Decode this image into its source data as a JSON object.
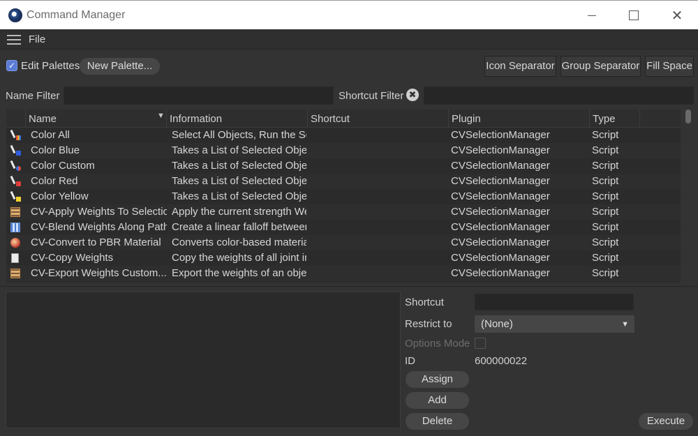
{
  "window": {
    "title": "Command Manager",
    "close_glyph": "✕"
  },
  "menu": {
    "file": "File"
  },
  "toolbar": {
    "edit_palettes_label": "Edit Palettes",
    "edit_palettes_checked": true,
    "checkmark": "✓",
    "new_palette": "New Palette...",
    "icon_separator": "Icon Separator",
    "group_separator": "Group Separator",
    "fill_space": "Fill Space"
  },
  "filters": {
    "name_label": "Name Filter",
    "shortcut_label": "Shortcut Filter",
    "name_value": "",
    "shortcut_value": "",
    "clear_glyph": "✖"
  },
  "table": {
    "columns": [
      "Name",
      "Information",
      "Shortcut",
      "Plugin",
      "Type"
    ],
    "sort_glyph": "▼",
    "rows": [
      {
        "icon": "color-all-icon",
        "name": "Color All",
        "information": "Select All Objects, Run the Scri",
        "shortcut": "",
        "plugin": "CVSelectionManager",
        "type": "Script"
      },
      {
        "icon": "color-blue-icon",
        "name": "Color Blue",
        "information": "Takes a List of Selected Object",
        "shortcut": "",
        "plugin": "CVSelectionManager",
        "type": "Script"
      },
      {
        "icon": "color-custom-icon",
        "name": "Color Custom",
        "information": "Takes a List of Selected Object",
        "shortcut": "",
        "plugin": "CVSelectionManager",
        "type": "Script"
      },
      {
        "icon": "color-red-icon",
        "name": "Color Red",
        "information": "Takes a List of Selected Object",
        "shortcut": "",
        "plugin": "CVSelectionManager",
        "type": "Script"
      },
      {
        "icon": "color-yellow-icon",
        "name": "Color Yellow",
        "information": "Takes a List of Selected Object",
        "shortcut": "",
        "plugin": "CVSelectionManager",
        "type": "Script"
      },
      {
        "icon": "apply-weights-icon",
        "name": "CV-Apply Weights To Selection",
        "information": "Apply the current strength We",
        "shortcut": "",
        "plugin": "CVSelectionManager",
        "type": "Script"
      },
      {
        "icon": "blend-weights-icon",
        "name": "CV-Blend Weights Along Path",
        "information": "Create a linear falloff between",
        "shortcut": "",
        "plugin": "CVSelectionManager",
        "type": "Script"
      },
      {
        "icon": "convert-pbr-icon",
        "name": "CV-Convert to PBR Material",
        "information": "Converts color-based material",
        "shortcut": "",
        "plugin": "CVSelectionManager",
        "type": "Script"
      },
      {
        "icon": "copy-weights-icon",
        "name": "CV-Copy Weights",
        "information": "Copy the weights of all joint in",
        "shortcut": "",
        "plugin": "CVSelectionManager",
        "type": "Script"
      },
      {
        "icon": "export-weights-icon",
        "name": "CV-Export Weights Custom...",
        "information": "Export the weights of an objec",
        "shortcut": "",
        "plugin": "CVSelectionManager",
        "type": "Script"
      }
    ]
  },
  "details": {
    "shortcut_label": "Shortcut",
    "shortcut_value": "",
    "restrict_label": "Restrict to",
    "restrict_value": "(None)",
    "dropdown_glyph": "▼",
    "options_mode_label": "Options Mode",
    "options_mode_checked": false,
    "id_label": "ID",
    "id_value": "600000022",
    "assign": "Assign",
    "add": "Add",
    "delete": "Delete",
    "execute": "Execute"
  }
}
